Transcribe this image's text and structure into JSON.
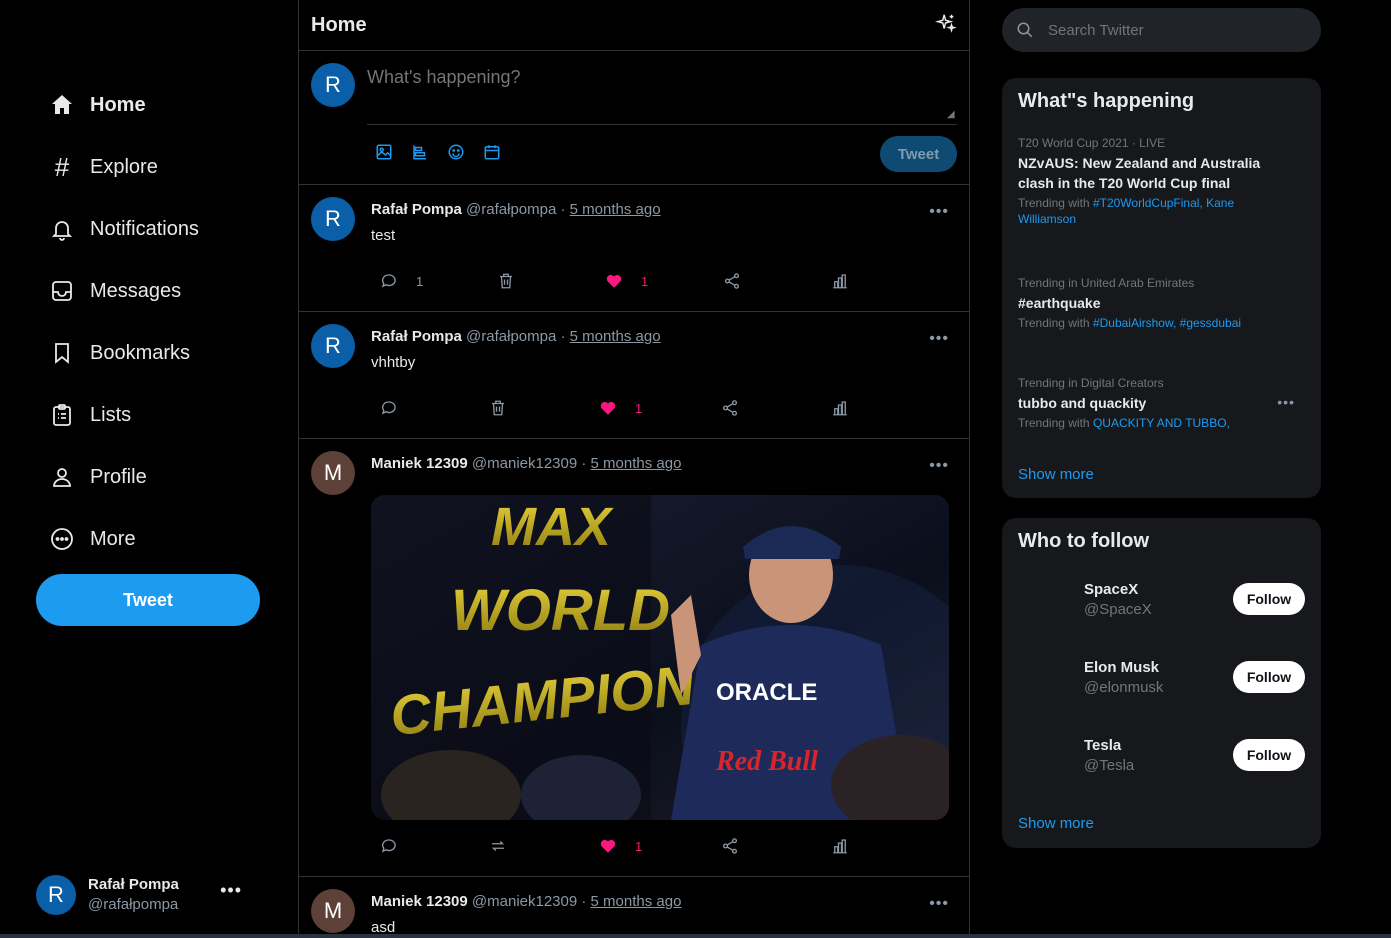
{
  "nav": {
    "items": [
      {
        "label": "Home",
        "icon": "home-icon"
      },
      {
        "label": "Explore",
        "icon": "hashtag-icon"
      },
      {
        "label": "Notifications",
        "icon": "bell-icon"
      },
      {
        "label": "Messages",
        "icon": "inbox-icon"
      },
      {
        "label": "Bookmarks",
        "icon": "bookmark-icon"
      },
      {
        "label": "Lists",
        "icon": "list-icon"
      },
      {
        "label": "Profile",
        "icon": "user-icon"
      },
      {
        "label": "More",
        "icon": "more-circle-icon"
      }
    ],
    "tweet_button": "Tweet"
  },
  "account": {
    "avatar_letter": "R",
    "name": "Rafał Pompa",
    "handle": "@rafałpompa",
    "menu": "•••"
  },
  "header": {
    "title": "Home"
  },
  "composer": {
    "avatar_letter": "R",
    "placeholder": "What's happening?",
    "tweet_button": "Tweet"
  },
  "tweets": [
    {
      "avatar_letter": "R",
      "name": "Rafał Pompa",
      "handle": "@rafałpompa",
      "sep": "·",
      "time": "5 months ago",
      "text": "test",
      "replies": "1",
      "likes": "1",
      "second_action": "delete"
    },
    {
      "avatar_letter": "R",
      "name": "Rafał Pompa",
      "handle": "@rafałpompa",
      "sep": "·",
      "time": "5 months ago",
      "text": "vhhtby",
      "replies": "",
      "likes": "1",
      "second_action": "delete"
    },
    {
      "avatar_letter": "M",
      "name": "Maniek 12309",
      "handle": "@maniek12309",
      "sep": "·",
      "time": "5 months ago",
      "text": "",
      "replies": "",
      "likes": "1",
      "second_action": "retweet",
      "image_text": {
        "line1": "MAX",
        "line2": "WORLD",
        "line3": "CHAMPION",
        "sponsor1": "ORACLE",
        "sponsor2": "Red Bull"
      }
    },
    {
      "avatar_letter": "M",
      "name": "Maniek 12309",
      "handle": "@maniek12309",
      "sep": "·",
      "time": "5 months ago",
      "text": "asd"
    }
  ],
  "search": {
    "placeholder": "Search Twitter"
  },
  "trends": {
    "title": "What\"s happening",
    "items": [
      {
        "context": "T20 World Cup 2021 · LIVE",
        "title": "NZvAUS: New Zealand and Australia clash in the T20 World Cup final",
        "with_label": "Trending with ",
        "with_tags": "#T20WorldCupFinal, Kane Williamson"
      },
      {
        "context": "Trending in United Arab Emirates",
        "title": "#earthquake",
        "with_label": "Trending with ",
        "with_tags": "#DubaiAirshow, #gessdubai"
      },
      {
        "context": "Trending in Digital Creators",
        "title": "tubbo and quackity",
        "with_label": "Trending with ",
        "with_tags": "QUACKITY AND TUBBO,"
      }
    ],
    "show_more": "Show more"
  },
  "who_to_follow": {
    "title": "Who to follow",
    "accounts": [
      {
        "name": "SpaceX",
        "handle": "@SpaceX",
        "button": "Follow"
      },
      {
        "name": "Elon Musk",
        "handle": "@elonmusk",
        "button": "Follow"
      },
      {
        "name": "Tesla",
        "handle": "@Tesla",
        "button": "Follow"
      }
    ],
    "show_more": "Show more"
  },
  "colors": {
    "accent": "#1d9bf0",
    "like": "#f91880",
    "background": "#000000",
    "panel": "#16181c"
  }
}
